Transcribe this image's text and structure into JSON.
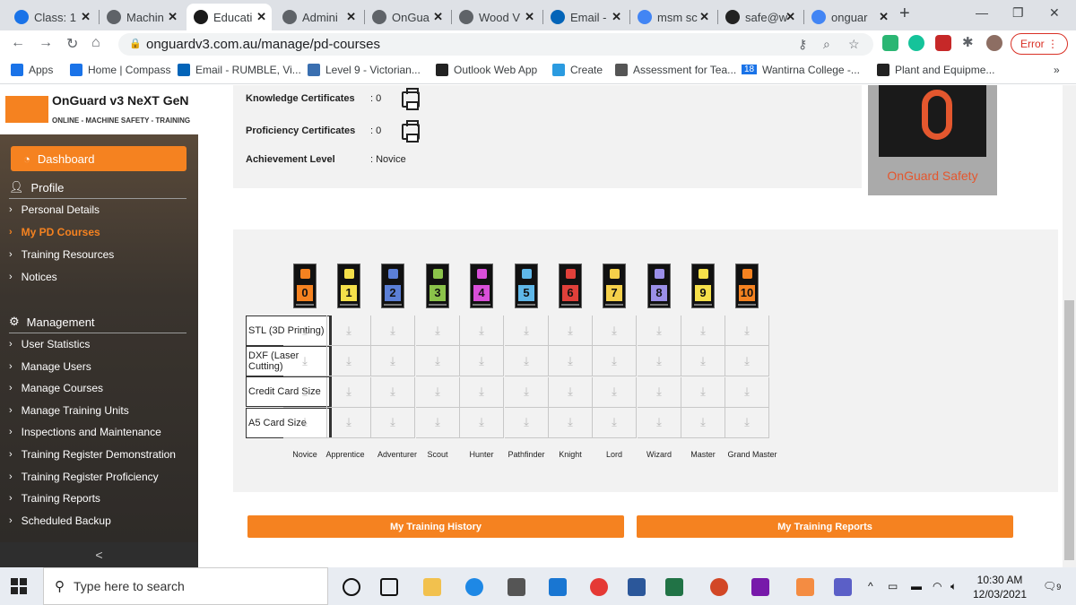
{
  "browser": {
    "tabs": [
      {
        "title": "Class: 1",
        "icon": "chrome-icon",
        "color": "#1a73e8",
        "active": false
      },
      {
        "title": "Machin",
        "icon": "globe-icon",
        "color": "#5f6368",
        "active": false
      },
      {
        "title": "Educati",
        "icon": "education-icon",
        "color": "#1a1a1a",
        "active": true
      },
      {
        "title": "Admini",
        "icon": "globe-icon",
        "color": "#5f6368",
        "active": false
      },
      {
        "title": "OnGua",
        "icon": "globe-icon",
        "color": "#5f6368",
        "active": false
      },
      {
        "title": "Wood V",
        "icon": "globe-icon",
        "color": "#5f6368",
        "active": false
      },
      {
        "title": "Email -",
        "icon": "outlook-icon",
        "color": "#0364b8",
        "active": false
      },
      {
        "title": "msm sc",
        "icon": "google-icon",
        "color": "#4285f4",
        "active": false
      },
      {
        "title": "safe@w",
        "icon": "mail-icon",
        "color": "#222",
        "active": false
      },
      {
        "title": "onguar",
        "icon": "google-icon",
        "color": "#4285f4",
        "active": false
      }
    ],
    "url": "onguardv3.com.au/manage/pd-courses",
    "error_label": "Error",
    "bookmarks": [
      {
        "label": "Apps",
        "color": "#1a73e8"
      },
      {
        "label": "Home | Compass",
        "color": "#1a73e8"
      },
      {
        "label": "Email - RUMBLE, Vi...",
        "color": "#0364b8"
      },
      {
        "label": "Level 9 - Victorian...",
        "color": "#3a6fb0"
      },
      {
        "label": "Outlook Web App",
        "color": "#222"
      },
      {
        "label": "Create",
        "color": "#2b9be0"
      },
      {
        "label": "Assessment for Tea...",
        "color": "#555"
      },
      {
        "label": "Wantirna College -...",
        "color": "#1a73e8"
      },
      {
        "label": "Plant and Equipme...",
        "color": "#222"
      }
    ],
    "bookmark_badge": "18",
    "more_bookmarks": "»"
  },
  "sidebar": {
    "brand_name": "OnGuard v3 NeXT GeN",
    "brand_tagline": "ONLINE - MACHINE SAFETY - TRAINING",
    "dashboard_label": "Dashboard",
    "profile_heading": "Profile",
    "profile_items": [
      "Personal Details",
      "My PD Courses",
      "Training Resources",
      "Notices"
    ],
    "management_heading": "Management",
    "management_items": [
      "User Statistics",
      "Manage Users",
      "Manage Courses",
      "Manage Training Units",
      "Inspections and Maintenance",
      "Training Register Demonstration",
      "Training Register Proficiency",
      "Training Reports",
      "Scheduled Backup"
    ],
    "collapse_glyph": "<",
    "accent": "#f58220"
  },
  "certificates": {
    "knowledge_label": "Knowledge Certificates",
    "knowledge_value": ": 0",
    "proficiency_label": "Proficiency Certificates",
    "proficiency_value": ": 0",
    "achievement_label": "Achievement Level",
    "achievement_value": ": Novice"
  },
  "logo_card": {
    "label": "OnGuard Safety"
  },
  "levels": {
    "numbers": [
      "0",
      "1",
      "2",
      "3",
      "4",
      "5",
      "6",
      "7",
      "8",
      "9",
      "10"
    ],
    "badge_colors": [
      "#f58220",
      "#f5e04a",
      "#5b7fd6",
      "#8bc34a",
      "#d94fd9",
      "#5fb7e8",
      "#e0403a",
      "#f5d04a",
      "#9b8fe8",
      "#f5e04a",
      "#f58220"
    ],
    "names": [
      "Novice",
      "Apprentice",
      "Adventurer",
      "Scout",
      "Hunter",
      "Pathfinder",
      "Knight",
      "Lord",
      "Wizard",
      "Master",
      "Grand Master"
    ],
    "rows": [
      "STL (3D Printing)",
      "DXF (Laser Cutting)",
      "Credit Card Size",
      "A5 Card Size"
    ],
    "download_glyph": "⤓"
  },
  "buttons": {
    "history": "My Training History",
    "reports": "My Training Reports"
  },
  "taskbar": {
    "search_placeholder": "Type here to search",
    "time": "10:30 AM",
    "date": "12/03/2021",
    "notifications": "9"
  }
}
